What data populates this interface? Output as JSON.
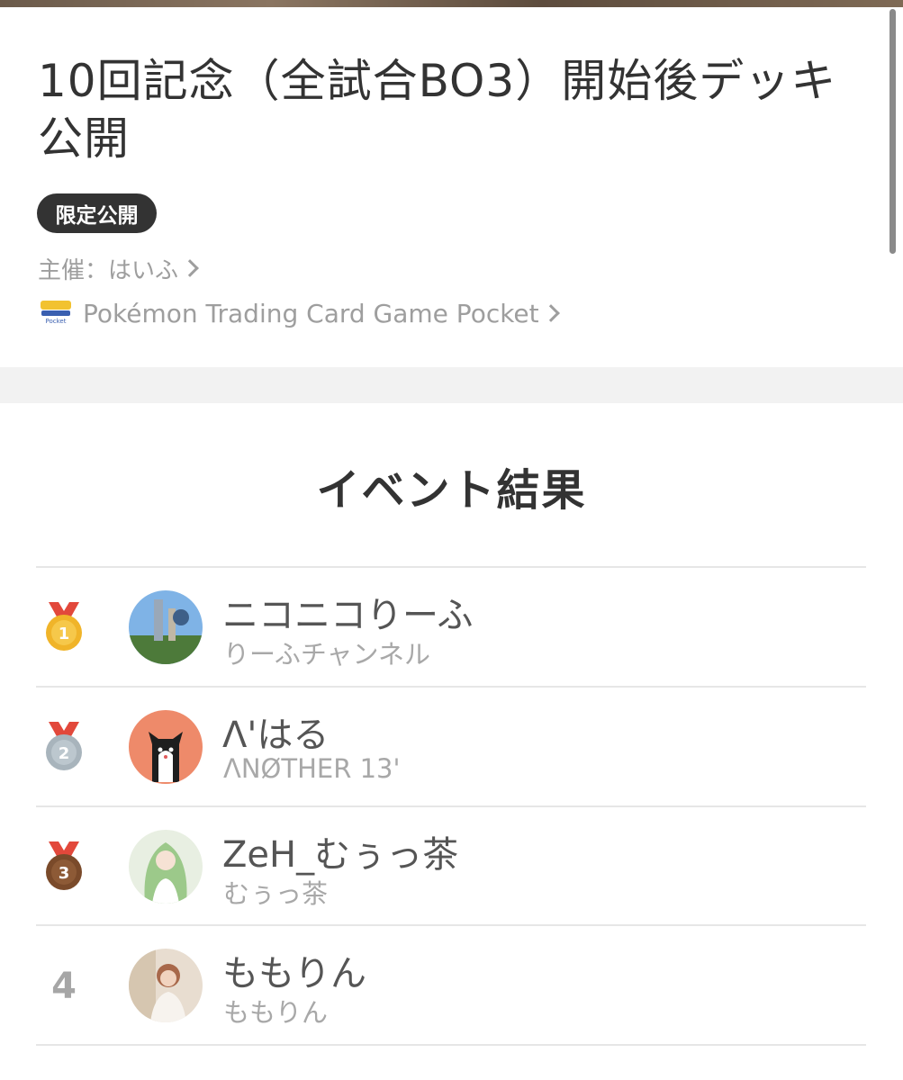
{
  "event": {
    "title": "10回記念（全試合BO3）開始後デッキ公開",
    "badge": "限定公開",
    "organizer": "主催：はいふ",
    "game": "Pokémon Trading Card Game Pocket"
  },
  "results": {
    "heading": "イベント結果",
    "entries": [
      {
        "rank": "1",
        "name": "ニコニコりーふ",
        "team": "りーふチャンネル",
        "medal": "gold"
      },
      {
        "rank": "2",
        "name": "Λ'はる",
        "team": "ΛNØTHER 13'",
        "medal": "silver"
      },
      {
        "rank": "3",
        "name": "ZeH_むぅっ茶",
        "team": "むぅっ茶",
        "medal": "bronze"
      },
      {
        "rank": "4",
        "name": "ももりん",
        "team": "ももりん",
        "medal": "none"
      }
    ]
  },
  "colors": {
    "gold": "#f0b429",
    "silver": "#a8b4bc",
    "bronze": "#7a4a2a",
    "ribbon": "#e2483b"
  }
}
